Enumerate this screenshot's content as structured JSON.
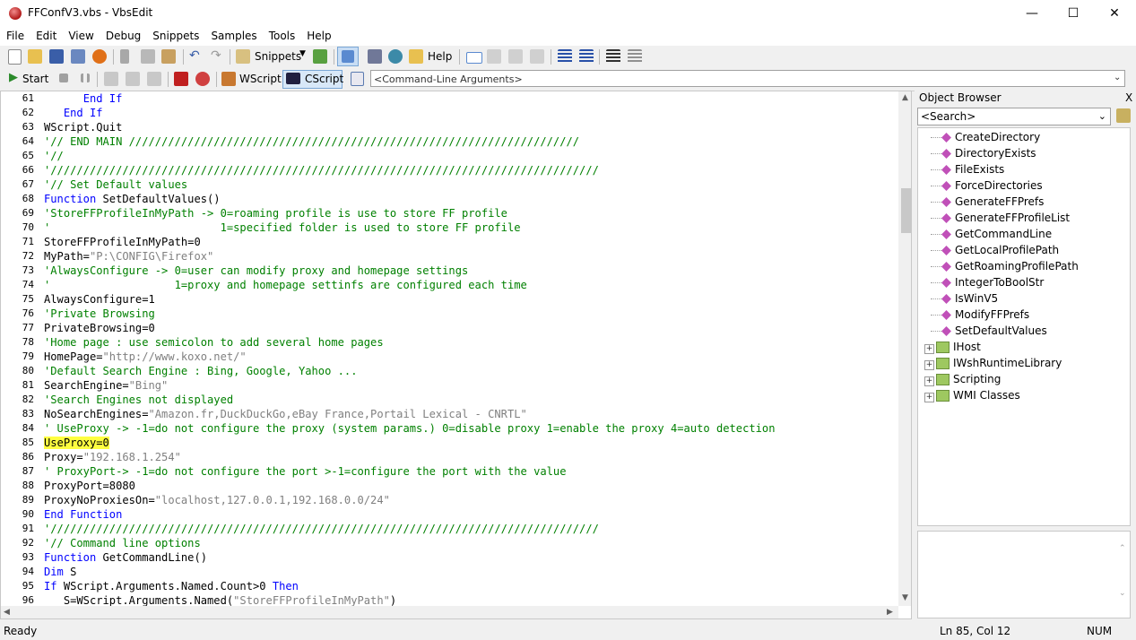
{
  "window": {
    "title": "FFConfV3.vbs - VbsEdit"
  },
  "menu": [
    "File",
    "Edit",
    "View",
    "Debug",
    "Snippets",
    "Samples",
    "Tools",
    "Help"
  ],
  "toolbar1": {
    "snippets_label": "Snippets",
    "help_label": "Help"
  },
  "toolbar2": {
    "start_label": "Start",
    "wscript_label": "WScript",
    "cscript_label": "CScript",
    "args_placeholder": "<Command-Line Arguments>"
  },
  "editor": {
    "line_numbers": [
      "61",
      "62",
      "63",
      "64",
      "65",
      "66",
      "67",
      "68",
      "69",
      "70",
      "71",
      "72",
      "73",
      "74",
      "75",
      "76",
      "77",
      "78",
      "79",
      "80",
      "81",
      "82",
      "83",
      "84",
      "85",
      "86",
      "87",
      "88",
      "89",
      "90",
      "91",
      "92",
      "93",
      "94",
      "95",
      "96"
    ],
    "lines": [
      [
        {
          "t": "      "
        },
        {
          "t": "End If",
          "c": "kw"
        }
      ],
      [
        {
          "t": "   "
        },
        {
          "t": "End If",
          "c": "kw"
        }
      ],
      [
        {
          "t": "WScript.Quit"
        }
      ],
      [
        {
          "t": "'// END MAIN /////////////////////////////////////////////////////////////////////",
          "c": "cm"
        }
      ],
      [
        {
          "t": "'//",
          "c": "cm"
        }
      ],
      [
        {
          "t": "'////////////////////////////////////////////////////////////////////////////////////",
          "c": "cm"
        }
      ],
      [
        {
          "t": "'// Set Default values",
          "c": "cm"
        }
      ],
      [
        {
          "t": "Function",
          "c": "kw"
        },
        {
          "t": " SetDefaultValues()"
        }
      ],
      [
        {
          "t": "'StoreFFProfileInMyPath -> 0=roaming profile is use to store FF profile",
          "c": "cm"
        }
      ],
      [
        {
          "t": "'                          1=specified folder is used to store FF profile",
          "c": "cm"
        }
      ],
      [
        {
          "t": "StoreFFProfileInMyPath=0"
        }
      ],
      [
        {
          "t": "MyPath="
        },
        {
          "t": "\"P:\\CONFIG\\Firefox\"",
          "c": "st"
        }
      ],
      [
        {
          "t": "'AlwaysConfigure -> 0=user can modify proxy and homepage settings",
          "c": "cm"
        }
      ],
      [
        {
          "t": "'                   1=proxy and homepage settinfs are configured each time",
          "c": "cm"
        }
      ],
      [
        {
          "t": "AlwaysConfigure=1"
        }
      ],
      [
        {
          "t": "'Private Browsing",
          "c": "cm"
        }
      ],
      [
        {
          "t": "PrivateBrowsing=0"
        }
      ],
      [
        {
          "t": "'Home page : use semicolon to add several home pages",
          "c": "cm"
        }
      ],
      [
        {
          "t": "HomePage="
        },
        {
          "t": "\"http://www.koxo.net/\"",
          "c": "st"
        }
      ],
      [
        {
          "t": "'Default Search Engine : Bing, Google, Yahoo ...",
          "c": "cm"
        }
      ],
      [
        {
          "t": "SearchEngine="
        },
        {
          "t": "\"Bing\"",
          "c": "st"
        }
      ],
      [
        {
          "t": "'Search Engines not displayed",
          "c": "cm"
        }
      ],
      [
        {
          "t": "NoSearchEngines="
        },
        {
          "t": "\"Amazon.fr,DuckDuckGo,eBay France,Portail Lexical - CNRTL\"",
          "c": "st"
        }
      ],
      [
        {
          "t": "' UseProxy -> -1=do not configure the proxy (system params.) 0=disable proxy 1=enable the proxy 4=auto detection",
          "c": "cm"
        }
      ],
      [
        {
          "t": "UseProxy=0",
          "hl": true
        }
      ],
      [
        {
          "t": "Proxy="
        },
        {
          "t": "\"192.168.1.254\"",
          "c": "st"
        }
      ],
      [
        {
          "t": "' ProxyPort-> -1=do not configure the port >-1=configure the port with the value",
          "c": "cm"
        }
      ],
      [
        {
          "t": "ProxyPort=8080"
        }
      ],
      [
        {
          "t": "ProxyNoProxiesOn="
        },
        {
          "t": "\"localhost,127.0.0.1,192.168.0.0/24\"",
          "c": "st"
        }
      ],
      [
        {
          "t": "End Function",
          "c": "kw"
        }
      ],
      [
        {
          "t": "'////////////////////////////////////////////////////////////////////////////////////",
          "c": "cm"
        }
      ],
      [
        {
          "t": "'// Command line options",
          "c": "cm"
        }
      ],
      [
        {
          "t": "Function",
          "c": "kw"
        },
        {
          "t": " GetCommandLine()"
        }
      ],
      [
        {
          "t": "Dim",
          "c": "kw"
        },
        {
          "t": " S"
        }
      ],
      [
        {
          "t": "If",
          "c": "kw"
        },
        {
          "t": " WScript.Arguments.Named.Count>0 "
        },
        {
          "t": "Then",
          "c": "kw"
        }
      ],
      [
        {
          "t": "   S=WScript.Arguments.Named("
        },
        {
          "t": "\"StoreFFProfileInMyPath\"",
          "c": "st"
        },
        {
          "t": ")"
        }
      ]
    ]
  },
  "object_browser": {
    "title": "Object Browser",
    "close": "X",
    "search_placeholder": "<Search>",
    "methods": [
      "CreateDirectory",
      "DirectoryExists",
      "FileExists",
      "ForceDirectories",
      "GenerateFFPrefs",
      "GenerateFFProfileList",
      "GetCommandLine",
      "GetLocalProfilePath",
      "GetRoamingProfilePath",
      "IntegerToBoolStr",
      "IsWinV5",
      "ModifyFFPrefs",
      "SetDefaultValues"
    ],
    "libraries": [
      "IHost",
      "IWshRuntimeLibrary",
      "Scripting",
      "WMI Classes"
    ]
  },
  "status": {
    "left": "Ready",
    "position": "Ln 85, Col 12",
    "num": "NUM"
  }
}
